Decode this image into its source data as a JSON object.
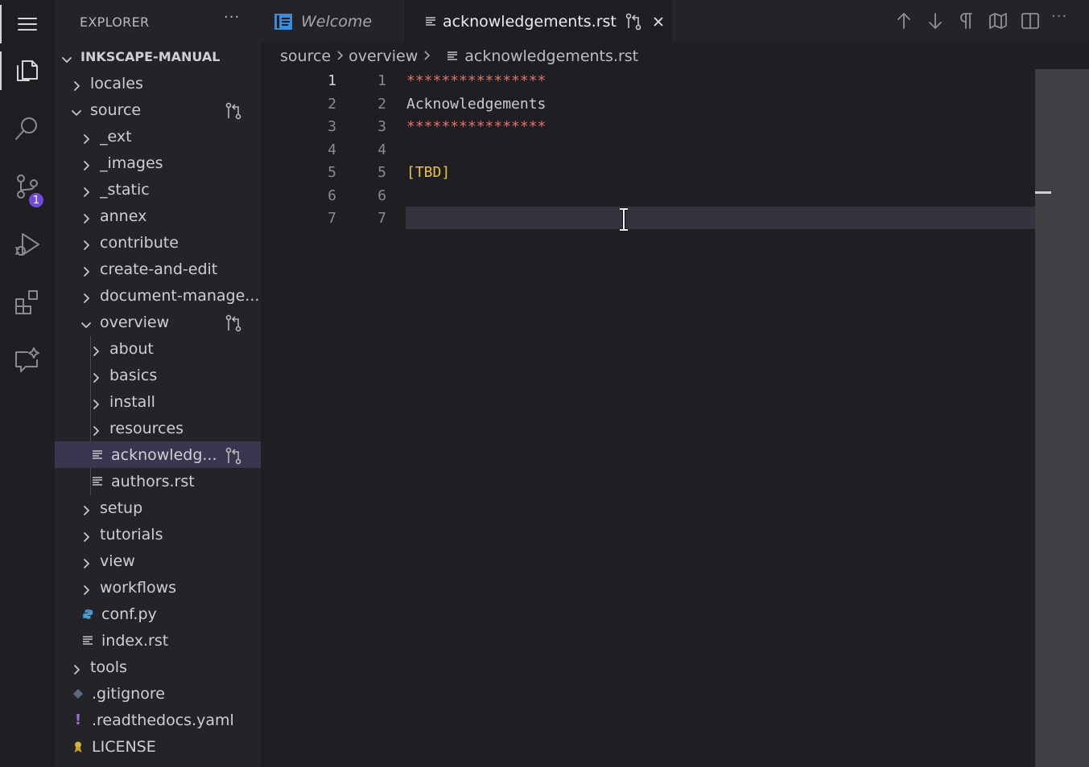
{
  "activity_bar": {
    "items": [
      {
        "name": "explorer-icon"
      },
      {
        "name": "search-icon"
      },
      {
        "name": "source-control-icon",
        "badge": "1"
      },
      {
        "name": "run-debug-icon"
      },
      {
        "name": "extensions-icon"
      },
      {
        "name": "chat-sparkle-icon"
      }
    ],
    "badge_color": "#6f4bd8"
  },
  "sidebar": {
    "title": "EXPLORER",
    "more": "···",
    "root": "INKSCAPE-MANUAL",
    "tree": [
      {
        "label": "locales",
        "type": "folder",
        "open": false
      },
      {
        "label": "source",
        "type": "folder",
        "open": true
      },
      {
        "label": "_ext",
        "type": "folder",
        "open": false
      },
      {
        "label": "_images",
        "type": "folder",
        "open": false
      },
      {
        "label": "_static",
        "type": "folder",
        "open": false
      },
      {
        "label": "annex",
        "type": "folder",
        "open": false
      },
      {
        "label": "contribute",
        "type": "folder",
        "open": false
      },
      {
        "label": "create-and-edit",
        "type": "folder",
        "open": false
      },
      {
        "label": "document-manage...",
        "type": "folder",
        "open": false
      },
      {
        "label": "overview",
        "type": "folder",
        "open": true
      },
      {
        "label": "about",
        "type": "folder",
        "open": false
      },
      {
        "label": "basics",
        "type": "folder",
        "open": false
      },
      {
        "label": "install",
        "type": "folder",
        "open": false
      },
      {
        "label": "resources",
        "type": "folder",
        "open": false
      },
      {
        "label": "acknowledg...",
        "type": "file",
        "selected": true
      },
      {
        "label": "authors.rst",
        "type": "file"
      },
      {
        "label": "setup",
        "type": "folder",
        "open": false
      },
      {
        "label": "tutorials",
        "type": "folder",
        "open": false
      },
      {
        "label": "view",
        "type": "folder",
        "open": false
      },
      {
        "label": "workflows",
        "type": "folder",
        "open": false
      },
      {
        "label": "conf.py",
        "type": "python"
      },
      {
        "label": "index.rst",
        "type": "file"
      },
      {
        "label": "tools",
        "type": "folder",
        "open": false
      },
      {
        "label": ".gitignore",
        "type": "git"
      },
      {
        "label": ".readthedocs.yaml",
        "type": "yaml"
      },
      {
        "label": "LICENSE",
        "type": "license"
      }
    ]
  },
  "tabs": [
    {
      "label": "Welcome",
      "active": false
    },
    {
      "label": "acknowledgements.rst",
      "active": true
    }
  ],
  "toolbar": {
    "icons": [
      "arrow-up-icon",
      "arrow-down-icon",
      "pilcrow-icon",
      "map-icon",
      "split-editor-icon",
      "more-icon"
    ],
    "more": "···"
  },
  "breadcrumb": [
    "source",
    "overview",
    "acknowledgements.rst"
  ],
  "editor": {
    "lines": [
      {
        "n1": "1",
        "n2": "1",
        "text": "****************",
        "color": "#e0736a"
      },
      {
        "n1": "2",
        "n2": "2",
        "text": "Acknowledgements",
        "color": "#cccccc"
      },
      {
        "n1": "3",
        "n2": "3",
        "text": "****************",
        "color": "#e0736a"
      },
      {
        "n1": "4",
        "n2": "4",
        "text": "",
        "color": "#cccccc"
      },
      {
        "n1": "5",
        "n2": "5",
        "text": "[TBD]",
        "color": "#e8c53a"
      },
      {
        "n1": "6",
        "n2": "6",
        "text": "",
        "color": "#cccccc"
      },
      {
        "n1": "7",
        "n2": "7",
        "text": "",
        "color": "#cccccc"
      }
    ],
    "current_line": 1
  }
}
